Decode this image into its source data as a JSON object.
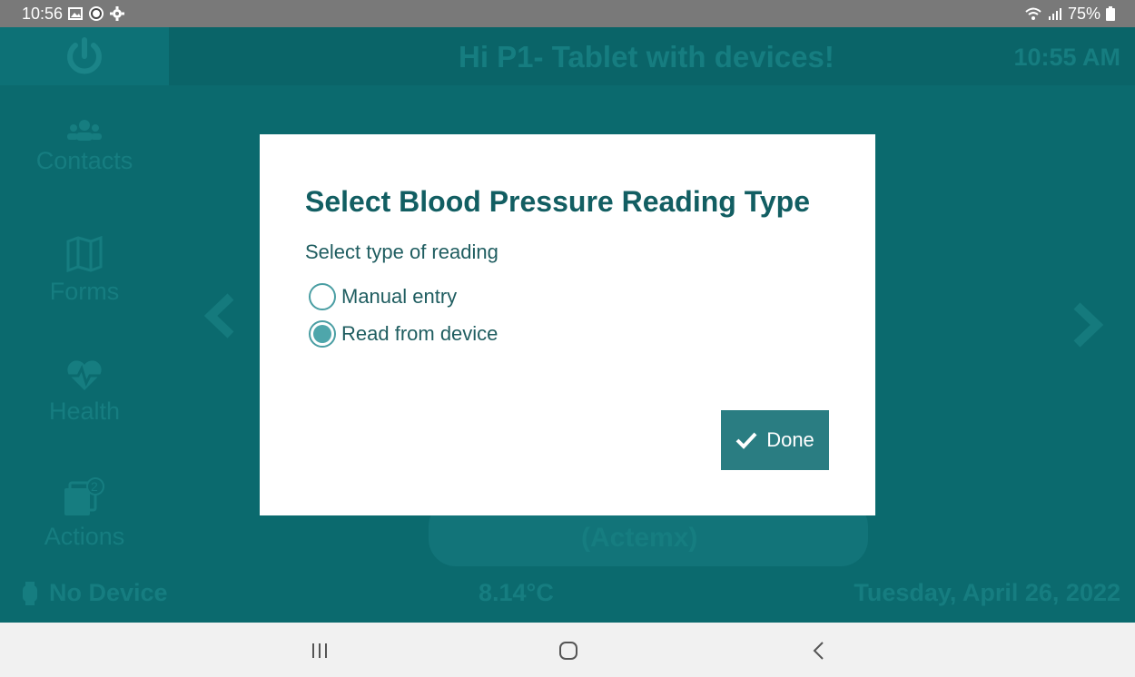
{
  "status_bar": {
    "time": "10:56",
    "battery": "75%",
    "icons": [
      "gallery-icon",
      "app-notification-icon",
      "settings-gear-icon",
      "wifi-icon",
      "signal-icon",
      "battery-icon"
    ]
  },
  "header": {
    "greeting": "Hi P1- Tablet with devices!",
    "clock": "10:55 AM"
  },
  "sidebar": {
    "items": [
      {
        "label": "Contacts",
        "icon": "contacts-icon"
      },
      {
        "label": "Forms",
        "icon": "map-forms-icon"
      },
      {
        "label": "Health",
        "icon": "heart-pulse-icon"
      },
      {
        "label": "Actions",
        "icon": "actions-icon",
        "badge": "2"
      }
    ]
  },
  "footer": {
    "device": "No Device",
    "temperature": "8.14°C",
    "date": "Tuesday, April 26, 2022"
  },
  "background_card": {
    "text": "(Actemx)"
  },
  "dialog": {
    "title": "Select Blood Pressure Reading Type",
    "subtitle": "Select type of reading",
    "options": [
      {
        "label": "Manual entry",
        "selected": false
      },
      {
        "label": "Read from device",
        "selected": true
      }
    ],
    "done_label": "Done"
  },
  "colors": {
    "accent": "#2a7d82",
    "title": "#125e62",
    "background": "#0b6a6e"
  }
}
